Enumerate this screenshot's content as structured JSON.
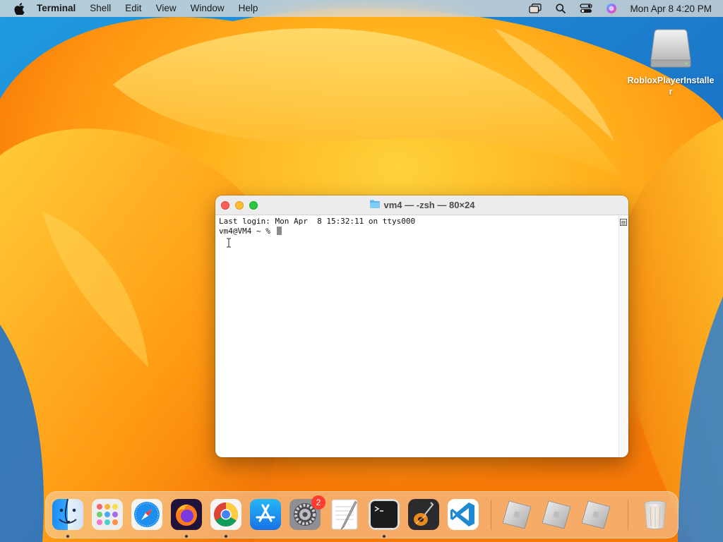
{
  "menubar": {
    "apple_icon": "apple-logo-icon",
    "app_name": "Terminal",
    "items": [
      "Shell",
      "Edit",
      "View",
      "Window",
      "Help"
    ],
    "status_icons": [
      "screen-mirroring-icon",
      "search-icon",
      "control-center-icon",
      "siri-icon"
    ],
    "clock": "Mon Apr 8  4:20 PM"
  },
  "desktop": {
    "items": [
      {
        "label": "RobloxPlayerInstaller",
        "icon": "disk-image-icon"
      }
    ]
  },
  "terminal_window": {
    "title": "vm4 — -zsh — 80×24",
    "title_icon": "folder-icon",
    "lines": [
      "Last login: Mon Apr  8 15:32:11 on ttys000",
      "vm4@VM4 ~ % "
    ]
  },
  "dock": {
    "apps": [
      {
        "name": "Finder",
        "icon": "finder-icon",
        "running": true
      },
      {
        "name": "Launchpad",
        "icon": "launchpad-icon",
        "running": false
      },
      {
        "name": "Safari",
        "icon": "safari-icon",
        "running": false
      },
      {
        "name": "Firefox",
        "icon": "firefox-icon",
        "running": true
      },
      {
        "name": "Google Chrome",
        "icon": "chrome-icon",
        "running": true
      },
      {
        "name": "App Store",
        "icon": "app-store-icon",
        "running": false
      },
      {
        "name": "System Settings",
        "icon": "system-settings-icon",
        "running": false,
        "badge": "2"
      },
      {
        "name": "TextEdit",
        "icon": "textedit-icon",
        "running": false
      },
      {
        "name": "Terminal",
        "icon": "terminal-icon",
        "running": true
      },
      {
        "name": "GarageBand",
        "icon": "garageband-icon",
        "running": false
      },
      {
        "name": "Visual Studio Code",
        "icon": "vscode-icon",
        "running": false
      },
      {
        "name": "Roblox",
        "icon": "roblox-icon",
        "running": false
      },
      {
        "name": "Roblox",
        "icon": "roblox-icon",
        "running": false
      },
      {
        "name": "Roblox",
        "icon": "roblox-icon",
        "running": false
      },
      {
        "name": "Trash",
        "icon": "trash-icon",
        "running": false
      }
    ]
  },
  "colors": {
    "close": "#fe5f57",
    "minimize": "#febc2e",
    "zoom": "#28c840",
    "badge": "#ff3b30"
  }
}
